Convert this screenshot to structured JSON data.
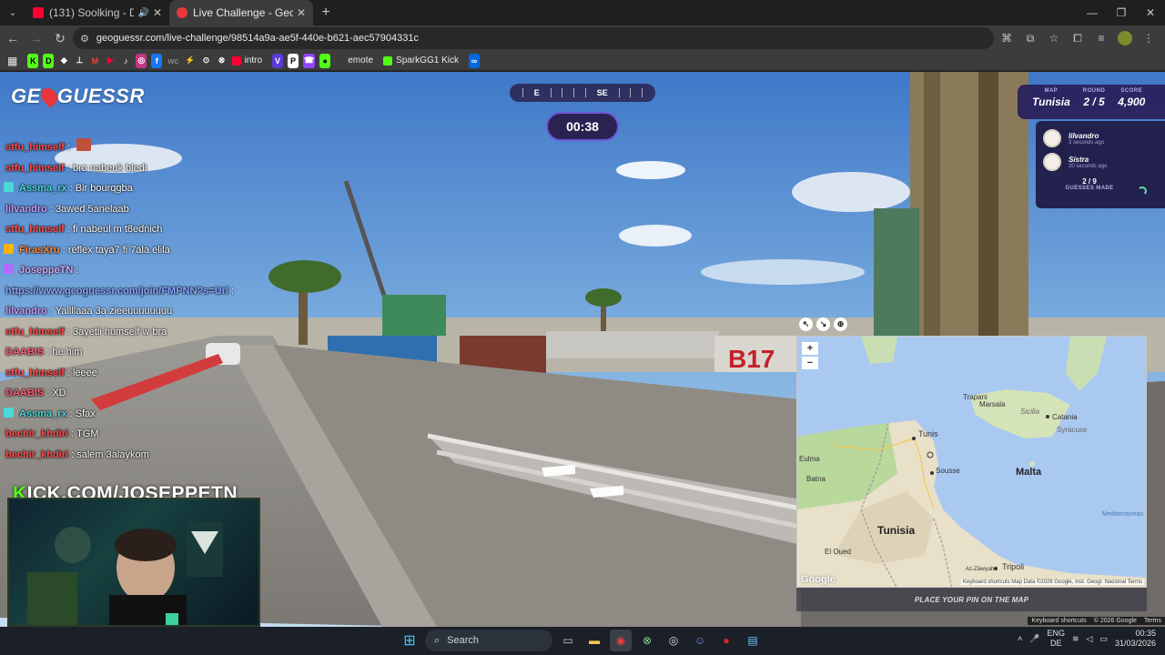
{
  "browser": {
    "tabs": [
      {
        "title": "(131) Soolking - Dalida [Cli",
        "favicon_color": "#ff0033",
        "audio_icon": "🔊"
      },
      {
        "title": "Live Challenge - GeoGuessr",
        "favicon_color": "#e8363a",
        "active": true
      }
    ],
    "new_tab_label": "+",
    "url": "geoguessr.com/live-challenge/98514a9a-ae5f-440e-b621-aec57904331c",
    "bookmarks": [
      {
        "label": "K",
        "color": "#53fc18",
        "fg": "#000"
      },
      {
        "label": "D",
        "color": "#53fc18",
        "fg": "#000"
      },
      {
        "label": "◆",
        "color": "#3c3c3c",
        "fg": "#fff"
      },
      {
        "label": "⊥",
        "color": "#3c3c3c",
        "fg": "#fff"
      },
      {
        "label": "M",
        "color": "#3c3c3c",
        "fg": "#ea4335"
      },
      {
        "label": "▶",
        "color": "#3c3c3c",
        "fg": "#ff0033"
      },
      {
        "label": "♪",
        "color": "#3c3c3c",
        "fg": "#fff"
      },
      {
        "label": "◎",
        "color": "#c13584",
        "fg": "#fff"
      },
      {
        "label": "f",
        "color": "#1877f2",
        "fg": "#fff"
      },
      {
        "label": "wc",
        "color": "#3c3c3c",
        "fg": "#888"
      },
      {
        "label": "⚡",
        "color": "#3c3c3c",
        "fg": "#ffd400"
      },
      {
        "label": "⊙",
        "color": "#3c3c3c",
        "fg": "#fff"
      },
      {
        "label": "⊗",
        "color": "#3c3c3c",
        "fg": "#fff"
      }
    ],
    "bookmark_texts": [
      {
        "label": "intro",
        "color": "#ff0033"
      },
      {
        "label": "V",
        "color": "#5a3bd8",
        "box": true
      },
      {
        "label": "P",
        "color": "#ffffff",
        "box": true,
        "fg": "#000"
      },
      {
        "label": "☎",
        "color": "#9146ff",
        "box": true
      },
      {
        "label": "●",
        "color": "#53fc18",
        "box": true,
        "fg": "#000"
      },
      {
        "label": "emote",
        "color": "#3c3c3c"
      },
      {
        "label": "SparkGG1 Kick",
        "color": "#53fc18"
      },
      {
        "label": "∞",
        "color": "#0668e1",
        "box": true
      }
    ]
  },
  "game": {
    "logo": "GEOGUESSR",
    "compass": {
      "east": "E",
      "southeast": "SE"
    },
    "timer": "00:38",
    "stats": {
      "map_label": "MAP",
      "map_value": "Tunisia",
      "round_label": "ROUND",
      "round_value": "2 / 5",
      "score_label": "SCORE",
      "score_value": "4,900"
    },
    "players": [
      {
        "name": "lilvandro",
        "time": "3 seconds ago"
      },
      {
        "name": "Sistra",
        "time": "20 seconds ago"
      }
    ],
    "guesses_count": "2 / 9",
    "guesses_label": "GUESSES MADE",
    "place_pin_label": "PLACE YOUR PIN ON THE MAP",
    "street_footer": [
      "Keyboard shortcuts",
      "© 2026 Google",
      "Terms"
    ]
  },
  "map": {
    "places": [
      {
        "name": "Trapani"
      },
      {
        "name": "Marsala"
      },
      {
        "name": "Sicilia"
      },
      {
        "name": "Catania"
      },
      {
        "name": "Syracuse"
      },
      {
        "name": "Tunis"
      },
      {
        "name": "Sousse"
      },
      {
        "name": "Malta"
      },
      {
        "name": "Tunisia"
      },
      {
        "name": "Tripoli"
      },
      {
        "name": "Batna"
      },
      {
        "name": "Eulma"
      },
      {
        "name": "El Oued"
      },
      {
        "name": "Mediterranean"
      },
      {
        "name": "Az-Zāwiyah"
      }
    ],
    "logo": "Google",
    "footer": "Keyboard shortcuts   Map Data ©2026 Google, Inst. Geogr. Nacional   Terms"
  },
  "chat": [
    {
      "user": "stfu_himself",
      "user_color": "#ff4d4d",
      "text": "",
      "emote": true
    },
    {
      "user": "stfu_himself",
      "user_color": "#ff4d4d",
      "text": "bro nabeuk bledi"
    },
    {
      "user": "Assma_rx",
      "user_color": "#4ad9d9",
      "text": "Bir bourqgba",
      "badge": "#4ad9d9"
    },
    {
      "user": "lilvandro",
      "user_color": "#c89bff",
      "text": "3awed 5anelaab"
    },
    {
      "user": "stfu_himself",
      "user_color": "#ff4d4d",
      "text": "fi nabeul m t8ednich"
    },
    {
      "user": "FirasXru",
      "user_color": "#ff8a3d",
      "text": "reflex taya7 fi 7ala elila",
      "badge": "#ffb300"
    },
    {
      "user": "JoseppeTN",
      "user_color": "#d6a9ff",
      "text": "",
      "badge": "#b06cff"
    },
    {
      "user": "https://www.geoguessr.com/join/FMPNN?s=Url",
      "user_color": "#8aa6ff",
      "text": ""
    },
    {
      "user": "lilvandro",
      "user_color": "#c89bff",
      "text": "Yallllaaa 3a zieeuuuuuuuu"
    },
    {
      "user": "stfu_himself",
      "user_color": "#ff4d4d",
      "text": "3ayetli humself w bra"
    },
    {
      "user": "DAABIS",
      "user_color": "#ff5e7a",
      "text": "he him"
    },
    {
      "user": "stfu_himself",
      "user_color": "#ff4d4d",
      "text": "leeee"
    },
    {
      "user": "DAABIS",
      "user_color": "#ff5e7a",
      "text": "XD"
    },
    {
      "user": "Assma_rx",
      "user_color": "#4ad9d9",
      "text": "Sfax",
      "badge": "#4ad9d9"
    },
    {
      "user": "bechir_khdiri",
      "user_color": "#ff4d4d",
      "text": "TGM"
    },
    {
      "user": "bechir_khdiri",
      "user_color": "#ff4d4d",
      "text": "salem 3alaykom"
    }
  ],
  "stream": {
    "kick_prefix": "K",
    "kick_rest": "ICK.COM/JOSEPPETN"
  },
  "taskbar": {
    "search_label": "Search",
    "lang_top": "ENG",
    "lang_bottom": "DE",
    "time": "00:35",
    "date": "31/03/2026"
  }
}
